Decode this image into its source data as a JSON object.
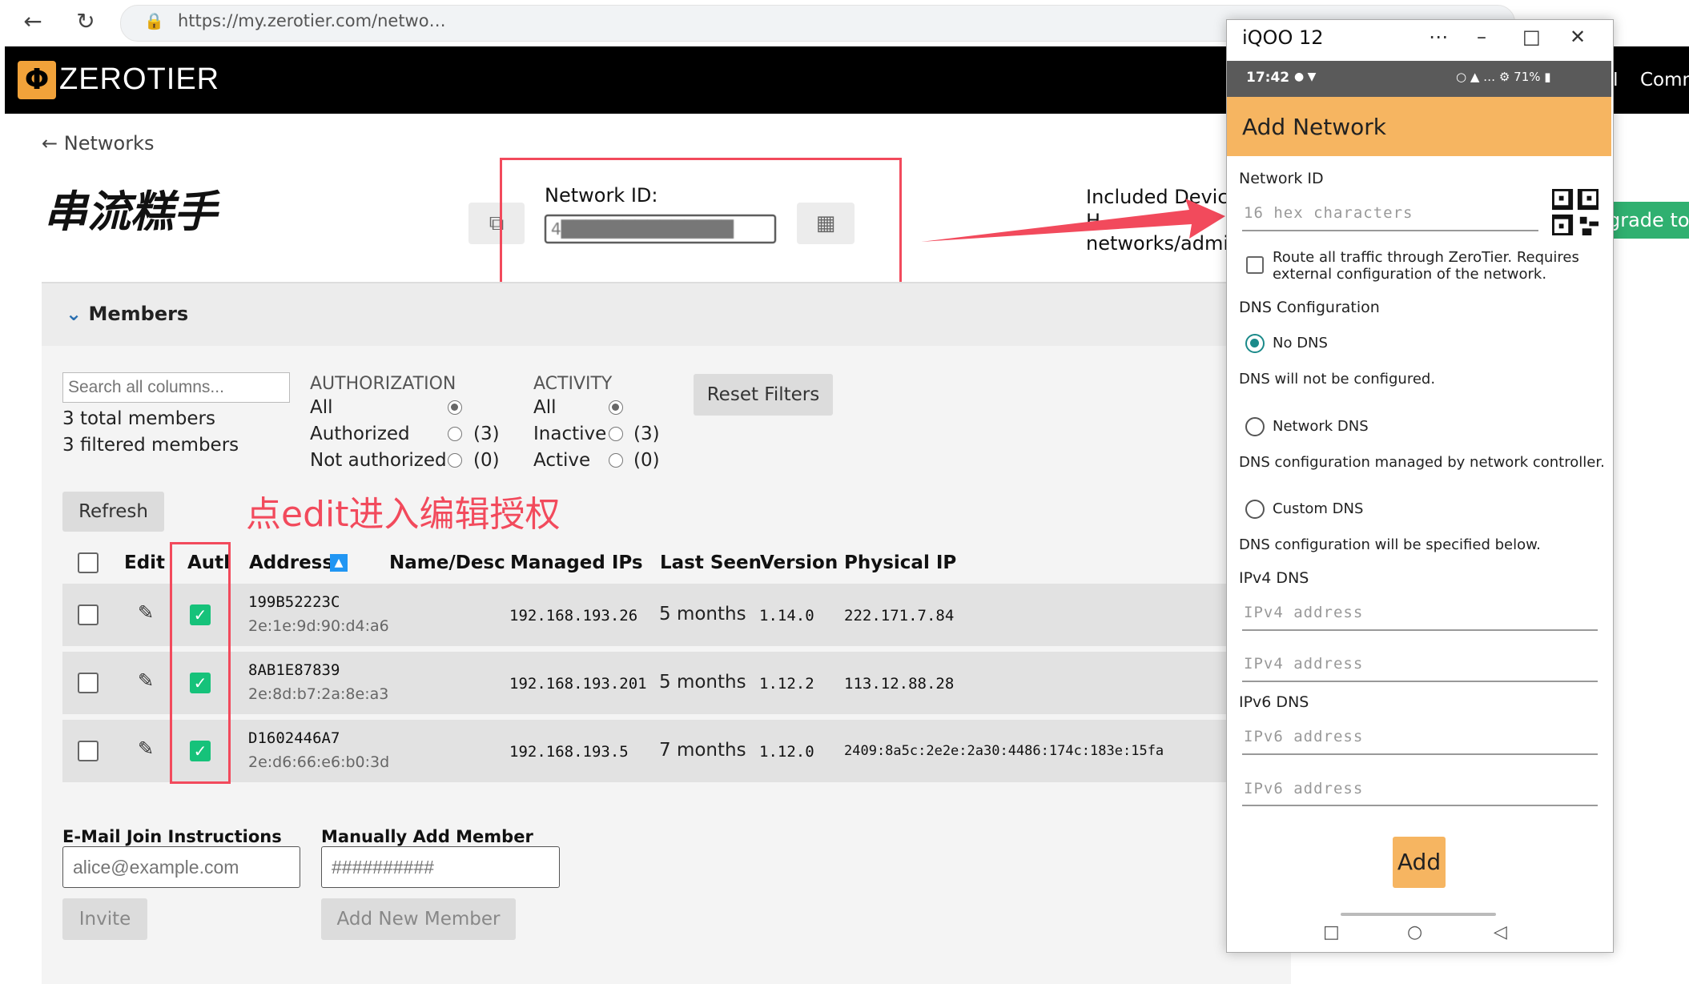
{
  "browser": {
    "url": "https://my.zerotier.com/netwo…"
  },
  "app": {
    "brand": "ZEROTIER",
    "logo_glyph": "Φ",
    "header_right": [
      "PI",
      "Comn"
    ]
  },
  "network": {
    "back_label": "Networks",
    "name": "串流糕手",
    "id_label": "Network ID:",
    "id_value": "4██████████████",
    "included_line1": "Included Devices",
    "included_line2": "H",
    "included_line3": "networks/admin",
    "upgrade_label": "grade to E"
  },
  "members": {
    "title": "Members",
    "search_placeholder": "Search all columns...",
    "total": "3 total members",
    "filtered": "3 filtered members",
    "authorization": {
      "heading": "AUTHORIZATION",
      "options": [
        {
          "label": "All",
          "count": "",
          "selected": true
        },
        {
          "label": "Authorized",
          "count": "(3)",
          "selected": false
        },
        {
          "label": "Not authorized",
          "count": "(0)",
          "selected": false
        }
      ]
    },
    "activity": {
      "heading": "ACTIVITY",
      "options": [
        {
          "label": "All",
          "count": "",
          "selected": true
        },
        {
          "label": "Inactive",
          "count": "(3)",
          "selected": false
        },
        {
          "label": "Active",
          "count": "(0)",
          "selected": false
        }
      ]
    },
    "reset_filters": "Reset Filters",
    "refresh": "Refresh",
    "annotation": "点edit进入编辑授权",
    "columns": {
      "edit": "Edit",
      "auth": "Auth",
      "address": "Address",
      "name": "Name/Desc",
      "managed_ips": "Managed IPs",
      "last_seen": "Last Seen",
      "version": "Version",
      "physical_ip": "Physical IP"
    },
    "rows": [
      {
        "address": "199B52223C",
        "mac": "2e:1e:9d:90:d4:a6",
        "managed_ip": "192.168.193.26",
        "last_seen": "5 months",
        "version": "1.14.0",
        "physical_ip": "222.171.7.84",
        "authorized": true
      },
      {
        "address": "8AB1E87839",
        "mac": "2e:8d:b7:2a:8e:a3",
        "managed_ip": "192.168.193.201",
        "last_seen": "5 months",
        "version": "1.12.2",
        "physical_ip": "113.12.88.28",
        "authorized": true
      },
      {
        "address": "D1602446A7",
        "mac": "2e:d6:66:e6:b0:3d",
        "managed_ip": "192.168.193.5",
        "last_seen": "7 months",
        "version": "1.12.0",
        "physical_ip": "2409:8a5c:2e2e:2a30:4486:174c:183e:15fa",
        "authorized": true
      }
    ],
    "email_label": "E-Mail Join Instructions",
    "email_placeholder": "alice@example.com",
    "invite": "Invite",
    "manual_label": "Manually Add Member",
    "manual_placeholder": "##########",
    "add_member": "Add New Member"
  },
  "phone": {
    "window_title": "iQOO 12",
    "time": "17:42",
    "battery": "71%",
    "appbar_title": "Add Network",
    "network_id_label": "Network ID",
    "network_id_placeholder": "16 hex characters",
    "route_all_text": "Route all traffic through ZeroTier. Requires external configuration of the network.",
    "dns_heading": "DNS Configuration",
    "dns_options": [
      {
        "label": "No DNS",
        "desc": "DNS will not be configured.",
        "selected": true
      },
      {
        "label": "Network DNS",
        "desc": "DNS configuration managed by network controller.",
        "selected": false
      },
      {
        "label": "Custom DNS",
        "desc": "DNS configuration will be specified below.",
        "selected": false
      }
    ],
    "ipv4_heading": "IPv4 DNS",
    "ipv4_placeholder": "IPv4 address",
    "ipv6_heading": "IPv6 DNS",
    "ipv6_placeholder": "IPv6 address",
    "add_button": "Add"
  },
  "colors": {
    "annotation_red": "#f24a5c",
    "phone_accent": "#f6b561",
    "auth_green": "#16c27a",
    "upgrade_green": "#30b070"
  }
}
